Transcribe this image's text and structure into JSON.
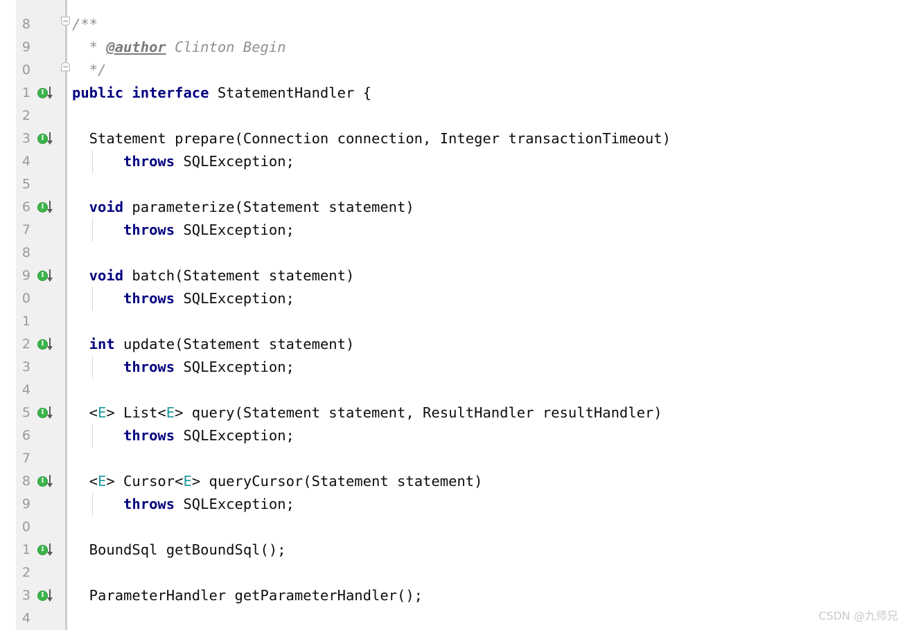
{
  "editor": {
    "gutter": {
      "marker_icon_glyph": "I",
      "marker_icon_name": "implemented-interface-marker",
      "marker_color": "#3cb44b",
      "fold_open_icon": "fold-collapse-icon",
      "fold_close_icon": "fold-end-icon"
    },
    "colors": {
      "background": "#ffffff",
      "gutter_background": "#f0f0f0",
      "gutter_divider": "#cdcdcd",
      "line_number": "#999999",
      "keyword": "#000080",
      "identifier": "#0d0d0d",
      "type_parameter": "#20999d",
      "comment": "#909090",
      "javadoc_tag": "#7a7a7a",
      "indent_guide": "#d4d4d4",
      "watermark": "#c9c9c9"
    },
    "lines": [
      {
        "num": "8",
        "marker": false,
        "fold": "down",
        "guide": false,
        "tokens": [
          {
            "t": "cmt",
            "s": "/**"
          }
        ]
      },
      {
        "num": "9",
        "marker": false,
        "fold": "stem",
        "guide": false,
        "tokens": [
          {
            "t": "cmt",
            "s": "  * "
          },
          {
            "t": "tag",
            "s": "@author"
          },
          {
            "t": "cmt",
            "s": " Clinton Begin"
          }
        ]
      },
      {
        "num": "0",
        "marker": false,
        "fold": "up",
        "guide": false,
        "tokens": [
          {
            "t": "cmt",
            "s": "  */"
          }
        ]
      },
      {
        "num": "1",
        "marker": true,
        "fold": "none",
        "guide": false,
        "tokens": [
          {
            "t": "kw",
            "s": "public interface"
          },
          {
            "t": "plain",
            "s": " StatementHandler {"
          }
        ]
      },
      {
        "num": "2",
        "marker": false,
        "fold": "none",
        "guide": false,
        "tokens": []
      },
      {
        "num": "3",
        "marker": true,
        "fold": "none",
        "guide": false,
        "tokens": [
          {
            "t": "plain",
            "s": "  Statement prepare(Connection connection, Integer transactionTimeout)"
          }
        ]
      },
      {
        "num": "4",
        "marker": false,
        "fold": "none",
        "guide": true,
        "tokens": [
          {
            "t": "kw",
            "s": "      throws"
          },
          {
            "t": "plain",
            "s": " SQLException;"
          }
        ]
      },
      {
        "num": "5",
        "marker": false,
        "fold": "none",
        "guide": false,
        "tokens": []
      },
      {
        "num": "6",
        "marker": true,
        "fold": "none",
        "guide": false,
        "tokens": [
          {
            "t": "kw",
            "s": "  void"
          },
          {
            "t": "plain",
            "s": " parameterize(Statement statement)"
          }
        ]
      },
      {
        "num": "7",
        "marker": false,
        "fold": "none",
        "guide": true,
        "tokens": [
          {
            "t": "kw",
            "s": "      throws"
          },
          {
            "t": "plain",
            "s": " SQLException;"
          }
        ]
      },
      {
        "num": "8",
        "marker": false,
        "fold": "none",
        "guide": false,
        "tokens": []
      },
      {
        "num": "9",
        "marker": true,
        "fold": "none",
        "guide": false,
        "tokens": [
          {
            "t": "kw",
            "s": "  void"
          },
          {
            "t": "plain",
            "s": " batch(Statement statement)"
          }
        ]
      },
      {
        "num": "0",
        "marker": false,
        "fold": "none",
        "guide": true,
        "tokens": [
          {
            "t": "kw",
            "s": "      throws"
          },
          {
            "t": "plain",
            "s": " SQLException;"
          }
        ]
      },
      {
        "num": "1",
        "marker": false,
        "fold": "none",
        "guide": false,
        "tokens": []
      },
      {
        "num": "2",
        "marker": true,
        "fold": "none",
        "guide": false,
        "tokens": [
          {
            "t": "kw",
            "s": "  int"
          },
          {
            "t": "plain",
            "s": " update(Statement statement)"
          }
        ]
      },
      {
        "num": "3",
        "marker": false,
        "fold": "none",
        "guide": true,
        "tokens": [
          {
            "t": "kw",
            "s": "      throws"
          },
          {
            "t": "plain",
            "s": " SQLException;"
          }
        ]
      },
      {
        "num": "4",
        "marker": false,
        "fold": "none",
        "guide": false,
        "tokens": []
      },
      {
        "num": "5",
        "marker": true,
        "fold": "none",
        "guide": false,
        "tokens": [
          {
            "t": "plain",
            "s": "  <"
          },
          {
            "t": "type",
            "s": "E"
          },
          {
            "t": "plain",
            "s": "> List<"
          },
          {
            "t": "type",
            "s": "E"
          },
          {
            "t": "plain",
            "s": "> query(Statement statement, ResultHandler resultHandler)"
          }
        ]
      },
      {
        "num": "6",
        "marker": false,
        "fold": "none",
        "guide": true,
        "tokens": [
          {
            "t": "kw",
            "s": "      throws"
          },
          {
            "t": "plain",
            "s": " SQLException;"
          }
        ]
      },
      {
        "num": "7",
        "marker": false,
        "fold": "none",
        "guide": false,
        "tokens": []
      },
      {
        "num": "8",
        "marker": true,
        "fold": "none",
        "guide": false,
        "tokens": [
          {
            "t": "plain",
            "s": "  <"
          },
          {
            "t": "type",
            "s": "E"
          },
          {
            "t": "plain",
            "s": "> Cursor<"
          },
          {
            "t": "type",
            "s": "E"
          },
          {
            "t": "plain",
            "s": "> queryCursor(Statement statement)"
          }
        ]
      },
      {
        "num": "9",
        "marker": false,
        "fold": "none",
        "guide": true,
        "tokens": [
          {
            "t": "kw",
            "s": "      throws"
          },
          {
            "t": "plain",
            "s": " SQLException;"
          }
        ]
      },
      {
        "num": "0",
        "marker": false,
        "fold": "none",
        "guide": false,
        "tokens": []
      },
      {
        "num": "1",
        "marker": true,
        "fold": "none",
        "guide": false,
        "tokens": [
          {
            "t": "plain",
            "s": "  BoundSql getBoundSql();"
          }
        ]
      },
      {
        "num": "2",
        "marker": false,
        "fold": "none",
        "guide": false,
        "tokens": []
      },
      {
        "num": "3",
        "marker": true,
        "fold": "none",
        "guide": false,
        "tokens": [
          {
            "t": "plain",
            "s": "  ParameterHandler getParameterHandler();"
          }
        ]
      },
      {
        "num": "4",
        "marker": false,
        "fold": "none",
        "guide": false,
        "tokens": []
      }
    ]
  },
  "watermark": {
    "text": "CSDN @九师兄"
  }
}
